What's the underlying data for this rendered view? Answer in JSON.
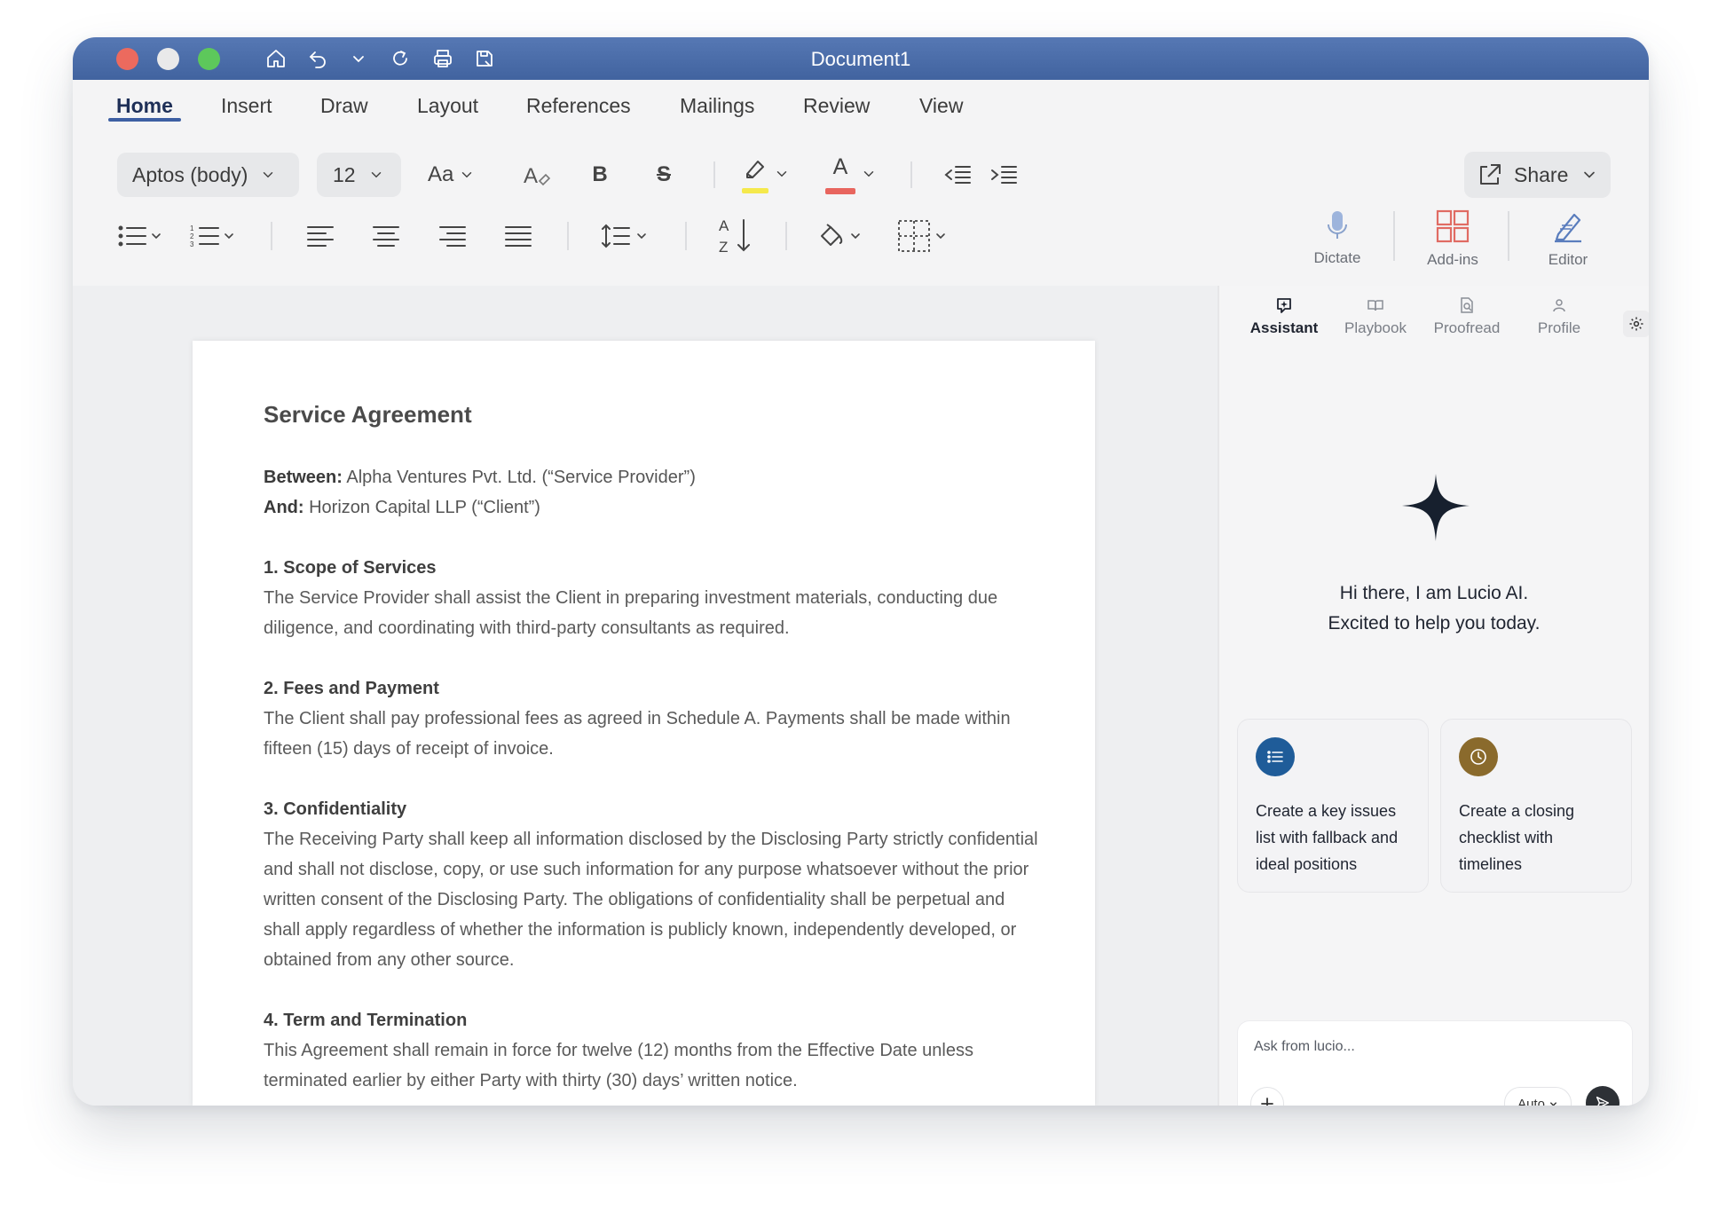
{
  "window": {
    "title": "Document1"
  },
  "menu": {
    "tabs": [
      {
        "label": "Home",
        "active": true
      },
      {
        "label": "Insert"
      },
      {
        "label": "Draw"
      },
      {
        "label": "Layout"
      },
      {
        "label": "References"
      },
      {
        "label": "Mailings"
      },
      {
        "label": "Review"
      },
      {
        "label": "View"
      }
    ]
  },
  "ribbon": {
    "font_name": "Aptos (body)",
    "font_size": "12",
    "case_label": "Aa",
    "bold_label": "B",
    "strike_label": "S",
    "font_color_label": "A",
    "highlight_color": "#f5e94c",
    "font_color": "#e8655e",
    "share_label": "Share",
    "dictate_label": "Dictate",
    "addins_label": "Add-ins",
    "editor_label": "Editor"
  },
  "document": {
    "heading": "Service Agreement",
    "between_label": "Between:",
    "between_value": "Alpha Ventures Pvt. Ltd. (“Service Provider”)",
    "and_label": "And:",
    "and_value": "Horizon Capital LLP (“Client”)",
    "sections": [
      {
        "title": "1. Scope of Services",
        "body": "The Service Provider shall assist the Client in preparing investment materials, conducting due diligence, and coordinating with third-party consultants as required."
      },
      {
        "title": "2. Fees and Payment",
        "body": "The Client shall pay professional fees as agreed in Schedule A. Payments shall be made within fifteen (15) days of receipt of invoice."
      },
      {
        "title": "3. Confidentiality",
        "body": "The Receiving Party shall keep all information disclosed by the Disclosing Party strictly confidential and shall not disclose, copy, or use such information for any purpose whatsoever without the prior written consent of the Disclosing Party. The obligations of confidentiality shall be perpetual and shall apply regardless of whether the information is publicly known, independently developed, or obtained from any other source."
      },
      {
        "title": "4. Term and Termination",
        "body": "This Agreement shall remain in force for twelve (12) months from the Effective Date unless terminated earlier by either Party with thirty (30) days’ written notice."
      }
    ]
  },
  "panel": {
    "tabs": [
      {
        "label": "Assistant",
        "active": true
      },
      {
        "label": "Playbook"
      },
      {
        "label": "Proofread"
      },
      {
        "label": "Profile"
      }
    ],
    "greeting_line1": "Hi there, I am Lucio AI.",
    "greeting_line2": "Excited to help you today.",
    "cards": [
      {
        "text": "Create a key issues list with fallback and ideal positions",
        "icon": "list-icon",
        "color": "#1f5c99"
      },
      {
        "text": "Create a closing checklist with timelines",
        "icon": "clock-icon",
        "color": "#8a6a2c"
      }
    ],
    "input_placeholder": "Ask from lucio...",
    "model_select": "Auto"
  }
}
